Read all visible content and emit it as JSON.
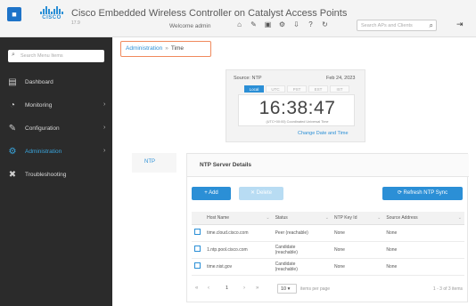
{
  "header": {
    "app_button_icon": "app-grid-icon",
    "logo_wordmark": "CISCO",
    "title": "Cisco Embedded Wireless Controller on Catalyst Access Points",
    "version": "17.9",
    "welcome": "Welcome admin",
    "search_placeholder": "Search APs and Clients",
    "icons": [
      "home-icon",
      "wrench-icon",
      "save-icon",
      "sync-icon",
      "download-icon",
      "help-icon",
      "refresh-icon"
    ]
  },
  "sidebar": {
    "search_placeholder": "Search Menu Items",
    "items": [
      {
        "label": "Dashboard",
        "icon": "dashboard-icon",
        "has_chevron": false,
        "active": false
      },
      {
        "label": "Monitoring",
        "icon": "monitoring-icon",
        "has_chevron": true,
        "active": false
      },
      {
        "label": "Configuration",
        "icon": "configuration-icon",
        "has_chevron": true,
        "active": false
      },
      {
        "label": "Administration",
        "icon": "administration-icon",
        "has_chevron": true,
        "active": true
      },
      {
        "label": "Troubleshooting",
        "icon": "troubleshooting-icon",
        "has_chevron": false,
        "active": false
      }
    ]
  },
  "breadcrumb": {
    "parent": "Administration",
    "separator": "»",
    "current": "Time"
  },
  "clock": {
    "source": "Source: NTP",
    "date": "Feb 24, 2023",
    "tabs": [
      "Local",
      "UTC",
      "PST",
      "EST",
      "IST"
    ],
    "selected_tab": 0,
    "time": "16:38:47",
    "subtitle": "(UTC+00:00) Coordinated Universal Time",
    "change_link": "Change Date and Time"
  },
  "side_tab": {
    "label": "NTP"
  },
  "ntp": {
    "title": "NTP Server Details",
    "add_label": "+ Add",
    "delete_label": "✕ Delete",
    "refresh_label": "⟳ Refresh NTP Sync",
    "columns": [
      "Host Name",
      "Status",
      "NTP Key Id",
      "Source Address"
    ],
    "rows": [
      {
        "host": "time.cloud.cisco.com",
        "status": [
          "Peer (reachable)"
        ],
        "key": "None",
        "src": "None"
      },
      {
        "host": "1.ntp.pool.cisco.com",
        "status": [
          "Candidate",
          "(reachable)"
        ],
        "key": "None",
        "src": "None"
      },
      {
        "host": "time.nist.gov",
        "status": [
          "Candidate",
          "(reachable)"
        ],
        "key": "None",
        "src": "None"
      }
    ],
    "pager": {
      "page": "1",
      "per_page": "10",
      "per_page_label": "items per page",
      "count": "1 - 3 of 3 items"
    }
  },
  "colors": {
    "accent": "#2b8fd6",
    "sidebar_bg": "#2b2b2b",
    "breadcrumb_highlight": "#f08a5d"
  }
}
